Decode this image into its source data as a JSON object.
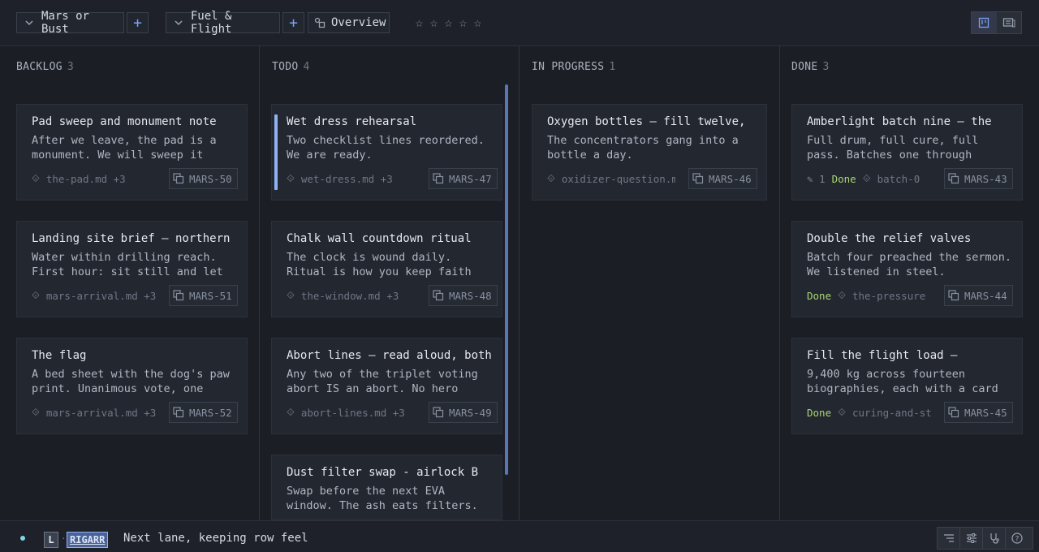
{
  "topbar": {
    "project_chip": "Mars or Bust",
    "board_chip": "Fuel & Flight",
    "overview_label": "Overview",
    "rating_stars": 5,
    "rating_value": 0
  },
  "columns": [
    {
      "name": "BACKLOG",
      "count": "3",
      "cards": [
        {
          "title": "Pad sweep and monument note",
          "body": "After we leave, the pad is a monument. We will sweep it",
          "link": "the-pad.md +3",
          "id": "MARS-50"
        },
        {
          "title": "Landing site brief — northern",
          "body": "Water within drilling reach. First hour: sit still and let",
          "link": "mars-arrival.md +3",
          "id": "MARS-51"
        },
        {
          "title": "The flag",
          "body": "A bed sheet with the dog's paw print. Unanimous vote, one",
          "link": "mars-arrival.md +3",
          "id": "MARS-52"
        }
      ]
    },
    {
      "name": "TODO",
      "count": "4",
      "cards": [
        {
          "title": "Wet dress rehearsal",
          "body": "Two checklist lines reordered. We are ready.",
          "link": "wet-dress.md +3",
          "id": "MARS-47"
        },
        {
          "title": "Chalk wall countdown ritual",
          "body": "The clock is wound daily. Ritual is how you keep faith",
          "link": "the-window.md +3",
          "id": "MARS-48"
        },
        {
          "title": "Abort lines — read aloud, both",
          "body": "Any two of the triplet voting abort IS an abort. No hero",
          "link": "abort-lines.md +3",
          "id": "MARS-49"
        },
        {
          "title": "Dust filter swap - airlock B",
          "body": "Swap before the next EVA window. The ash eats filters.",
          "link": "",
          "id": ""
        }
      ]
    },
    {
      "name": "IN PROGRESS",
      "count": "1",
      "cards": [
        {
          "title": "Oxygen bottles — fill twelve,",
          "body": "The concentrators gang into a bottle a day.",
          "link": "oxidizer-question.m",
          "id": "MARS-46"
        }
      ]
    },
    {
      "name": "DONE",
      "count": "3",
      "cards": [
        {
          "title": "Amberlight batch nine — the",
          "body": "Full drum, full cure, full pass. Batches one through",
          "edits": "1",
          "status": "Done",
          "link": "batch-0",
          "id": "MARS-43"
        },
        {
          "title": "Double the relief valves",
          "body": "Batch four preached the sermon. We listened in steel.",
          "status": "Done",
          "link": "the-pressure",
          "id": "MARS-44"
        },
        {
          "title": "Fill the flight load —",
          "body": "9,400 kg across fourteen biographies, each with a card",
          "status": "Done",
          "link": "curing-and-st",
          "id": "MARS-45"
        }
      ]
    }
  ],
  "statusbar": {
    "mode_key": "L",
    "mode_name": "RIGARR",
    "message": "Next lane, keeping row feel"
  },
  "colors": {
    "accent": "#7aa2f7",
    "done": "#a8d672",
    "focus": "#8fb2f5"
  }
}
